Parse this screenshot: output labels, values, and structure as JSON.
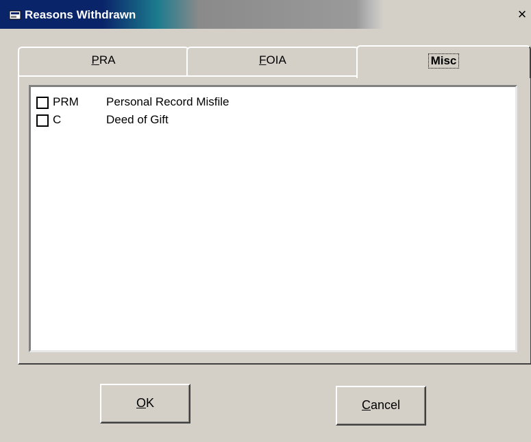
{
  "window": {
    "title": "Reasons Withdrawn",
    "close_glyph": "×"
  },
  "tabs": [
    {
      "label": "PRA",
      "mnemonic": "P",
      "active": false
    },
    {
      "label": "FOIA",
      "mnemonic": "F",
      "active": false
    },
    {
      "label": "Misc",
      "mnemonic": "",
      "active": true
    }
  ],
  "list": {
    "items": [
      {
        "code": "PRM",
        "description": "Personal Record Misfile",
        "checked": false
      },
      {
        "code": "C",
        "description": "Deed of Gift",
        "checked": false
      }
    ]
  },
  "buttons": {
    "ok": {
      "label": "OK",
      "mnemonic": "O"
    },
    "cancel": {
      "label": "Cancel",
      "mnemonic": "C"
    }
  },
  "icons": {
    "app": "window-app-icon",
    "close": "close-icon",
    "checkbox": "checkbox-unchecked"
  }
}
